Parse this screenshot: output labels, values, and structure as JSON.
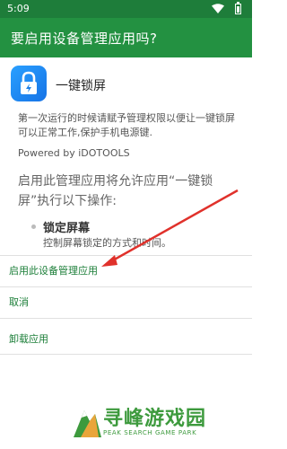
{
  "status_bar": {
    "time": "5:09"
  },
  "app_bar": {
    "title": "要启用设备管理应用吗?"
  },
  "app": {
    "name": "一键锁屏",
    "icon": "lock-icon"
  },
  "description": "第一次运行的时候请赋予管理权限以便让一键锁屏可以正常工作,保护手机电源键.",
  "powered_by": "Powered by iDOTOOLS",
  "permission_intro": "启用此管理应用将允许应用“一键锁屏”执行以下操作:",
  "policy": {
    "title": "锁定屏幕",
    "description": "控制屏幕锁定的方式和时间。"
  },
  "actions": {
    "activate": "启用此设备管理应用",
    "cancel": "取消",
    "uninstall": "卸载应用"
  },
  "watermark": {
    "title": "寻峰游戏园",
    "subtitle": "PEAK SEARCH GAME PARK"
  },
  "colors": {
    "status_bar": "#1e7d3a",
    "app_bar": "#239141",
    "accent": "#1b7e38",
    "arrow": "#e0312b"
  }
}
